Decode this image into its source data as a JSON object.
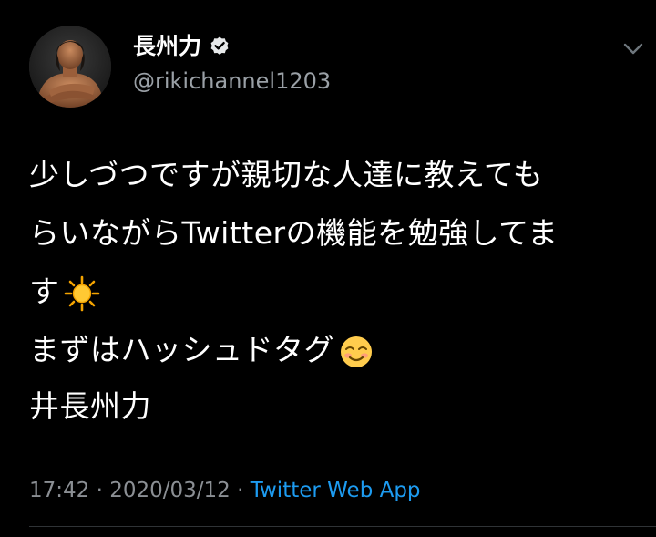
{
  "tweet": {
    "user": {
      "display_name": "長州力",
      "handle": "@rikichannel1203",
      "verified": true
    },
    "body_lines": [
      "少しづつですが親切な人達に教えても",
      "らいながらTwitterの機能を勉強してま",
      "す",
      "まずはハッシュドタグ"
    ],
    "emojis": {
      "line3": "sun-emoji",
      "line4": "smiling-face-emoji"
    },
    "hashtag_line": "井長州力",
    "meta": {
      "time": "17:42",
      "separator": " · ",
      "date": "2020/03/12",
      "source": "Twitter Web App"
    }
  },
  "icons": {
    "verified": "verified-badge-icon",
    "menu": "chevron-down-icon",
    "avatar": "user-avatar"
  },
  "colors": {
    "background": "#000000",
    "text": "#ffffff",
    "secondary_text": "#8b8f94",
    "link": "#1d9bf0",
    "verified_badge": "#e7e9ea"
  }
}
